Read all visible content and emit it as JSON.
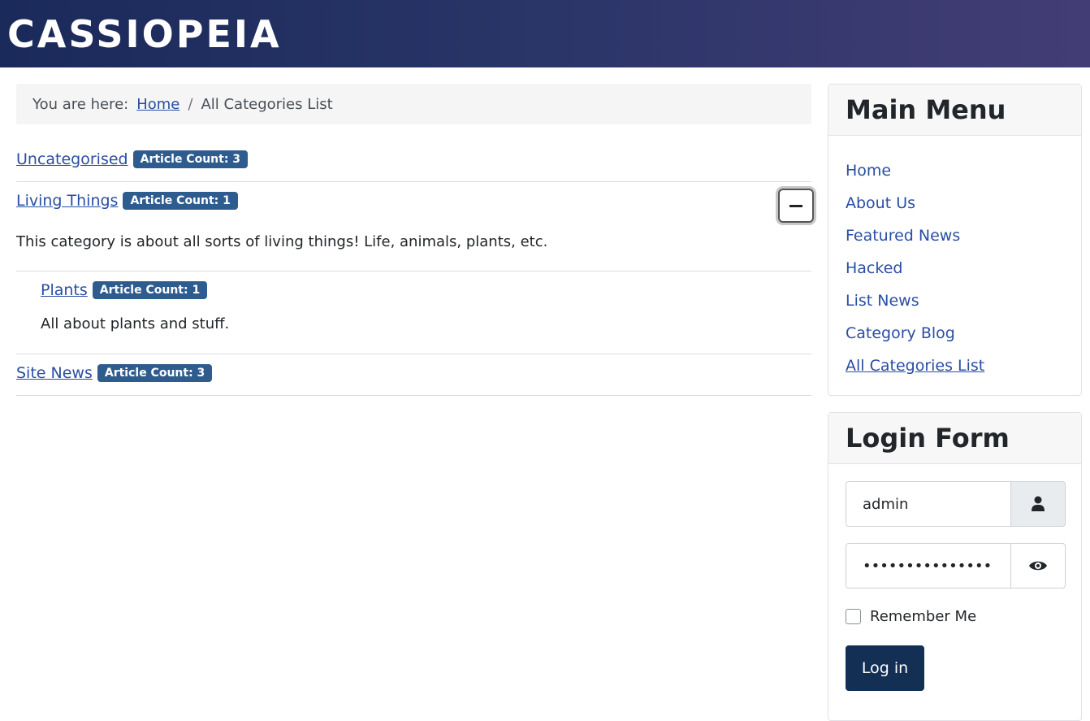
{
  "site": {
    "brand": "CASSIOPEIA"
  },
  "breadcrumb": {
    "prefix": "You are here:",
    "home": "Home",
    "separator": "/",
    "current": "All Categories List"
  },
  "categories": [
    {
      "name": "Uncategorised",
      "badge": "Article Count:  3"
    },
    {
      "name": "Living Things",
      "badge": "Article Count:  1",
      "description": "This category is about all sorts of living things! Life, animals, plants, etc."
    },
    {
      "name": "Plants",
      "badge": "Article Count:  1",
      "description": "All about plants and stuff."
    },
    {
      "name": "Site News",
      "badge": "Article Count:  3"
    }
  ],
  "icons": {
    "collapse": "minus-icon",
    "user": "user-icon",
    "password": "eye-icon"
  },
  "main_menu": {
    "title": "Main Menu",
    "items": [
      "Home",
      "About Us",
      "Featured News",
      "Hacked",
      "List News",
      "Category Blog",
      "All Categories List"
    ],
    "active": "All Categories List"
  },
  "login": {
    "title": "Login Form",
    "username": "admin",
    "password": "••••••••••••••••",
    "remember": "Remember Me",
    "submit": "Log in"
  },
  "colors": {
    "link": "#2a4ea3",
    "badge": "#2f5c8e",
    "button": "#132f53"
  }
}
